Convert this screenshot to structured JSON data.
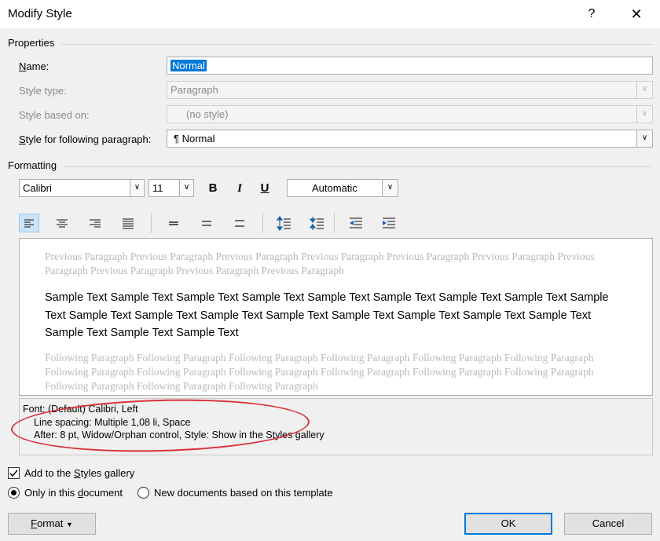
{
  "window": {
    "title": "Modify Style",
    "help_glyph": "?",
    "close_glyph": "✕"
  },
  "properties": {
    "section_label": "Properties",
    "name_label": "Name:",
    "name_value": "Normal",
    "style_type_label": "Style type:",
    "style_type_value": "Paragraph",
    "based_on_label": "Style based on:",
    "based_on_value": "(no style)",
    "following_label": "Style for following paragraph:",
    "following_value": "Normal",
    "following_icon": "¶"
  },
  "formatting": {
    "section_label": "Formatting",
    "font_name": "Calibri",
    "font_size": "11",
    "bold": "B",
    "italic": "I",
    "underline": "U",
    "color": "Automatic",
    "active_alignment": "align-left"
  },
  "preview": {
    "previous_text": "Previous Paragraph Previous Paragraph Previous Paragraph Previous Paragraph Previous Paragraph Previous Paragraph Previous Paragraph Previous Paragraph Previous Paragraph Previous Paragraph",
    "sample_text": "Sample Text Sample Text Sample Text Sample Text Sample Text Sample Text Sample Text Sample Text Sample Text Sample Text Sample Text Sample Text Sample Text Sample Text Sample Text Sample Text Sample Text Sample Text Sample Text Sample Text",
    "following_text": "Following Paragraph Following Paragraph Following Paragraph Following Paragraph Following Paragraph Following Paragraph Following Paragraph Following Paragraph Following Paragraph Following Paragraph Following Paragraph Following Paragraph Following Paragraph Following Paragraph Following Paragraph"
  },
  "description": {
    "line1": "Font: (Default) Calibri, Left",
    "line2": "Line spacing:  Multiple 1,08 li, Space",
    "line3": "After:  8 pt, Widow/Orphan control, Style: Show in the Styles gallery"
  },
  "options": {
    "add_to_gallery": "Add to the Styles gallery",
    "add_to_gallery_checked": true,
    "only_this_document": "Only in this document",
    "new_documents": "New documents based on this template",
    "selected_scope": "only_this_document"
  },
  "buttons": {
    "format": "Format",
    "ok": "OK",
    "cancel": "Cancel"
  },
  "colors": {
    "selection": "#0078d7",
    "annotation": "#d9303a"
  }
}
